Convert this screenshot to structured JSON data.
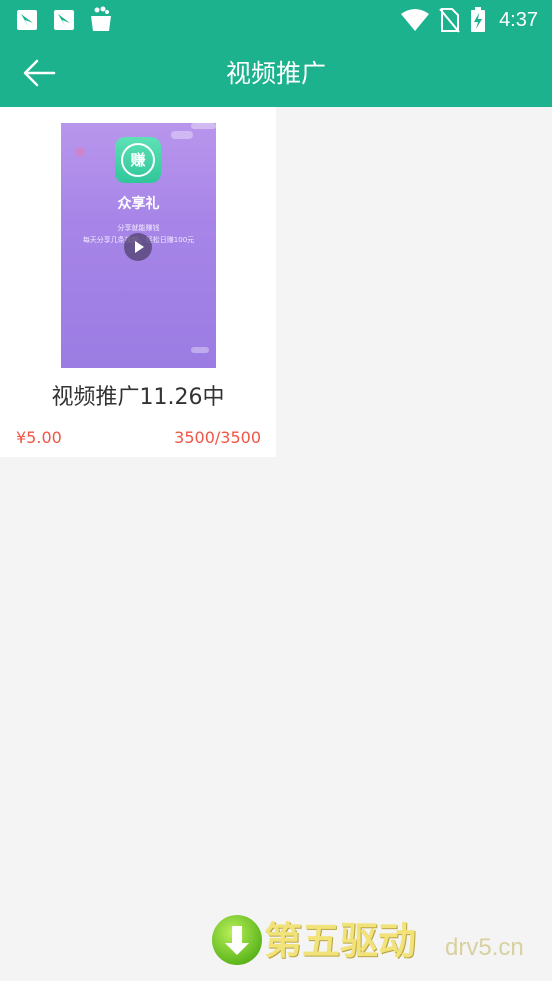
{
  "status_bar": {
    "time": "4:37",
    "icons": [
      "notification-app-icon",
      "notification-app-icon",
      "shopping-bag-icon",
      "wifi-icon",
      "no-sim-icon",
      "battery-charging-icon"
    ]
  },
  "header": {
    "title": "视频推广",
    "back_icon": "arrow-left-icon"
  },
  "videos": [
    {
      "title": "视频推广11.26中",
      "price": "¥5.00",
      "progress": "3500/3500",
      "thumbnail": {
        "logo_char": "赚",
        "brand": "众享礼",
        "line1": "分享就能赚钱",
        "line2": "每天分享几条视频，轻松日赚100元"
      }
    }
  ],
  "watermark": {
    "text": "第五驱动",
    "domain": "drv5.cn"
  },
  "colors": {
    "primary": "#1bb28d",
    "accent_red": "#f05545",
    "background": "#f4f4f4"
  }
}
